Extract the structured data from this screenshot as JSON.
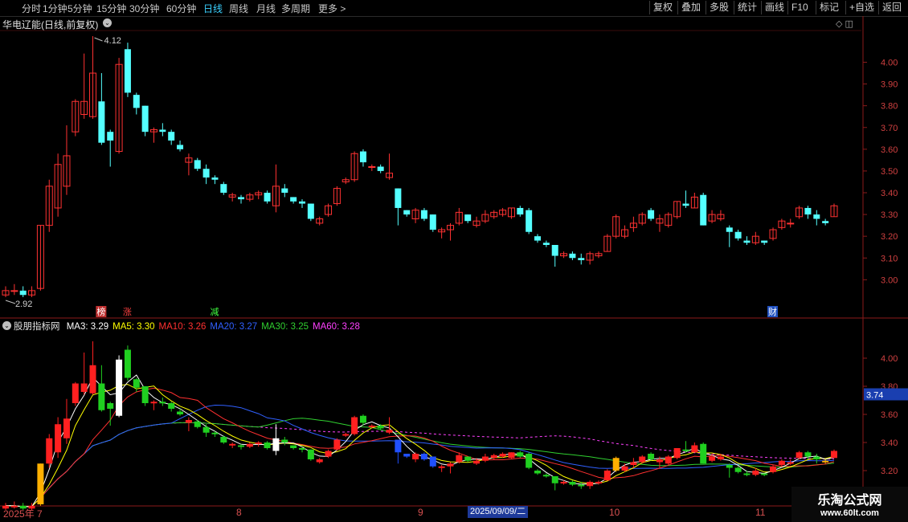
{
  "toolbar": {
    "periods": [
      {
        "label": "分时"
      },
      {
        "label": "1分钟"
      },
      {
        "label": "5分钟"
      },
      {
        "label": "15分钟"
      },
      {
        "label": "30分钟"
      },
      {
        "label": "60分钟"
      },
      {
        "label": "日线"
      },
      {
        "label": "周线"
      },
      {
        "label": "月线"
      },
      {
        "label": "多周期"
      },
      {
        "label": "更多 >"
      }
    ],
    "active": "日线",
    "right_buttons": [
      {
        "label": "复权"
      },
      {
        "label": "叠加"
      },
      {
        "label": "多股"
      },
      {
        "label": "统计"
      },
      {
        "label": "画线"
      },
      {
        "label": "F10"
      },
      {
        "label": "标记"
      },
      {
        "label": "+自选"
      },
      {
        "label": "返回"
      }
    ]
  },
  "main_title": "华电辽能(日线,前复权)",
  "indicator": {
    "name": "股朋指标网",
    "ma": [
      {
        "label": "MA3: 3.29",
        "color": "#ffffff"
      },
      {
        "label": "MA5: 3.30",
        "color": "#ffff00"
      },
      {
        "label": "MA10: 3.26",
        "color": "#ff3030"
      },
      {
        "label": "MA20: 3.27",
        "color": "#3060ff"
      },
      {
        "label": "MA30: 3.25",
        "color": "#30d030"
      },
      {
        "label": "MA60: 3.28",
        "color": "#ff40ff"
      }
    ]
  },
  "markers": {
    "high_label": "4.12",
    "low_label": "2.92",
    "events": [
      {
        "text": "榜",
        "color": "#ffffff",
        "bg": "#c03030"
      },
      {
        "text": "涨",
        "color": "#ff4040",
        "bg": ""
      },
      {
        "text": "减",
        "color": "#40ff40",
        "bg": ""
      },
      {
        "text": "财",
        "color": "#ffffff",
        "bg": "#2050c0"
      }
    ]
  },
  "price_labels": {
    "main_ticks": [
      "4.00",
      "3.90",
      "3.80",
      "3.70",
      "3.60",
      "3.50",
      "3.40",
      "3.30",
      "3.20",
      "3.10",
      "3.00"
    ],
    "sub_ticks": [
      "4.00",
      "3.80",
      "3.60",
      "3.40",
      "3.20"
    ],
    "current_price": "3.74"
  },
  "date_axis": [
    "2025年 7",
    "8",
    "9",
    "10",
    "11"
  ],
  "current_date": "2025/09/09/二",
  "watermark": {
    "title": "乐淘公式网",
    "url": "www.60lt.com"
  },
  "chart_data": {
    "type": "candlestick",
    "title": "华电辽能(日线,前复权)",
    "ylim_main": [
      2.92,
      4.12
    ],
    "ylim_sub": [
      3.12,
      4.12
    ],
    "up_color": "#ff3232",
    "down_color": "#54ffff",
    "candles": [
      {
        "o": 2.93,
        "h": 2.97,
        "l": 2.92,
        "c": 2.95
      },
      {
        "o": 2.95,
        "h": 2.98,
        "l": 2.93,
        "c": 2.95
      },
      {
        "o": 2.95,
        "h": 2.97,
        "l": 2.92,
        "c": 2.93
      },
      {
        "o": 2.93,
        "h": 2.97,
        "l": 2.92,
        "c": 2.95
      },
      {
        "o": 2.96,
        "h": 3.25,
        "l": 2.95,
        "c": 3.25
      },
      {
        "o": 3.25,
        "h": 3.46,
        "l": 3.22,
        "c": 3.43
      },
      {
        "o": 3.33,
        "h": 3.58,
        "l": 3.29,
        "c": 3.53
      },
      {
        "o": 3.43,
        "h": 3.71,
        "l": 3.39,
        "c": 3.57
      },
      {
        "o": 3.68,
        "h": 3.83,
        "l": 3.66,
        "c": 3.82
      },
      {
        "o": 3.76,
        "h": 4.04,
        "l": 3.74,
        "c": 3.82
      },
      {
        "o": 3.75,
        "h": 4.12,
        "l": 3.74,
        "c": 3.95
      },
      {
        "o": 3.82,
        "h": 3.95,
        "l": 3.62,
        "c": 3.63
      },
      {
        "o": 3.68,
        "h": 3.69,
        "l": 3.52,
        "c": 3.64
      },
      {
        "o": 3.59,
        "h": 4.02,
        "l": 3.58,
        "c": 3.99
      },
      {
        "o": 4.06,
        "h": 4.09,
        "l": 3.84,
        "c": 3.86
      },
      {
        "o": 3.85,
        "h": 3.86,
        "l": 3.76,
        "c": 3.79
      },
      {
        "o": 3.8,
        "h": 3.8,
        "l": 3.66,
        "c": 3.68
      },
      {
        "o": 3.68,
        "h": 3.7,
        "l": 3.63,
        "c": 3.69
      },
      {
        "o": 3.69,
        "h": 3.72,
        "l": 3.66,
        "c": 3.68
      },
      {
        "o": 3.68,
        "h": 3.69,
        "l": 3.62,
        "c": 3.64
      },
      {
        "o": 3.62,
        "h": 3.64,
        "l": 3.59,
        "c": 3.6
      },
      {
        "o": 3.54,
        "h": 3.58,
        "l": 3.48,
        "c": 3.56
      },
      {
        "o": 3.55,
        "h": 3.56,
        "l": 3.5,
        "c": 3.51
      },
      {
        "o": 3.51,
        "h": 3.53,
        "l": 3.44,
        "c": 3.47
      },
      {
        "o": 3.47,
        "h": 3.48,
        "l": 3.44,
        "c": 3.46
      },
      {
        "o": 3.44,
        "h": 3.45,
        "l": 3.39,
        "c": 3.4
      },
      {
        "o": 3.38,
        "h": 3.4,
        "l": 3.36,
        "c": 3.39
      },
      {
        "o": 3.38,
        "h": 3.39,
        "l": 3.35,
        "c": 3.37
      },
      {
        "o": 3.37,
        "h": 3.4,
        "l": 3.36,
        "c": 3.39
      },
      {
        "o": 3.39,
        "h": 3.41,
        "l": 3.37,
        "c": 3.4
      },
      {
        "o": 3.4,
        "h": 3.41,
        "l": 3.35,
        "c": 3.36
      },
      {
        "o": 3.34,
        "h": 3.53,
        "l": 3.31,
        "c": 3.43
      },
      {
        "o": 3.42,
        "h": 3.44,
        "l": 3.38,
        "c": 3.4
      },
      {
        "o": 3.38,
        "h": 3.38,
        "l": 3.35,
        "c": 3.36
      },
      {
        "o": 3.36,
        "h": 3.37,
        "l": 3.33,
        "c": 3.35
      },
      {
        "o": 3.35,
        "h": 3.35,
        "l": 3.27,
        "c": 3.28
      },
      {
        "o": 3.26,
        "h": 3.29,
        "l": 3.25,
        "c": 3.28
      },
      {
        "o": 3.3,
        "h": 3.35,
        "l": 3.29,
        "c": 3.34
      },
      {
        "o": 3.35,
        "h": 3.43,
        "l": 3.34,
        "c": 3.42
      },
      {
        "o": 3.45,
        "h": 3.47,
        "l": 3.44,
        "c": 3.46
      },
      {
        "o": 3.46,
        "h": 3.59,
        "l": 3.45,
        "c": 3.58
      },
      {
        "o": 3.59,
        "h": 3.6,
        "l": 3.52,
        "c": 3.54
      },
      {
        "o": 3.52,
        "h": 3.53,
        "l": 3.5,
        "c": 3.52
      },
      {
        "o": 3.52,
        "h": 3.53,
        "l": 3.49,
        "c": 3.5
      },
      {
        "o": 3.47,
        "h": 3.58,
        "l": 3.46,
        "c": 3.49
      },
      {
        "o": 3.42,
        "h": 3.42,
        "l": 3.25,
        "c": 3.33
      },
      {
        "o": 3.32,
        "h": 3.32,
        "l": 3.29,
        "c": 3.3
      },
      {
        "o": 3.28,
        "h": 3.33,
        "l": 3.26,
        "c": 3.32
      },
      {
        "o": 3.32,
        "h": 3.33,
        "l": 3.27,
        "c": 3.28
      },
      {
        "o": 3.3,
        "h": 3.3,
        "l": 3.22,
        "c": 3.23
      },
      {
        "o": 3.22,
        "h": 3.24,
        "l": 3.19,
        "c": 3.23
      },
      {
        "o": 3.23,
        "h": 3.26,
        "l": 3.18,
        "c": 3.25
      },
      {
        "o": 3.26,
        "h": 3.33,
        "l": 3.25,
        "c": 3.31
      },
      {
        "o": 3.3,
        "h": 3.3,
        "l": 3.26,
        "c": 3.27
      },
      {
        "o": 3.25,
        "h": 3.29,
        "l": 3.24,
        "c": 3.27
      },
      {
        "o": 3.27,
        "h": 3.32,
        "l": 3.26,
        "c": 3.3
      },
      {
        "o": 3.29,
        "h": 3.32,
        "l": 3.28,
        "c": 3.31
      },
      {
        "o": 3.3,
        "h": 3.33,
        "l": 3.29,
        "c": 3.32
      },
      {
        "o": 3.29,
        "h": 3.33,
        "l": 3.28,
        "c": 3.33
      },
      {
        "o": 3.33,
        "h": 3.34,
        "l": 3.29,
        "c": 3.3
      },
      {
        "o": 3.32,
        "h": 3.33,
        "l": 3.21,
        "c": 3.22
      },
      {
        "o": 3.2,
        "h": 3.21,
        "l": 3.17,
        "c": 3.18
      },
      {
        "o": 3.17,
        "h": 3.18,
        "l": 3.15,
        "c": 3.16
      },
      {
        "o": 3.16,
        "h": 3.16,
        "l": 3.06,
        "c": 3.11
      },
      {
        "o": 3.11,
        "h": 3.13,
        "l": 3.1,
        "c": 3.12
      },
      {
        "o": 3.12,
        "h": 3.13,
        "l": 3.09,
        "c": 3.1
      },
      {
        "o": 3.1,
        "h": 3.12,
        "l": 3.07,
        "c": 3.09
      },
      {
        "o": 3.09,
        "h": 3.13,
        "l": 3.07,
        "c": 3.12
      },
      {
        "o": 3.11,
        "h": 3.13,
        "l": 3.1,
        "c": 3.12
      },
      {
        "o": 3.13,
        "h": 3.21,
        "l": 3.13,
        "c": 3.2
      },
      {
        "o": 3.2,
        "h": 3.3,
        "l": 3.19,
        "c": 3.29
      },
      {
        "o": 3.2,
        "h": 3.25,
        "l": 3.19,
        "c": 3.23
      },
      {
        "o": 3.24,
        "h": 3.29,
        "l": 3.22,
        "c": 3.26
      },
      {
        "o": 3.26,
        "h": 3.31,
        "l": 3.25,
        "c": 3.3
      },
      {
        "o": 3.32,
        "h": 3.33,
        "l": 3.27,
        "c": 3.28
      },
      {
        "o": 3.26,
        "h": 3.3,
        "l": 3.22,
        "c": 3.28
      },
      {
        "o": 3.25,
        "h": 3.31,
        "l": 3.24,
        "c": 3.3
      },
      {
        "o": 3.29,
        "h": 3.36,
        "l": 3.28,
        "c": 3.36
      },
      {
        "o": 3.35,
        "h": 3.41,
        "l": 3.33,
        "c": 3.34
      },
      {
        "o": 3.33,
        "h": 3.4,
        "l": 3.33,
        "c": 3.38
      },
      {
        "o": 3.39,
        "h": 3.4,
        "l": 3.25,
        "c": 3.25
      },
      {
        "o": 3.27,
        "h": 3.32,
        "l": 3.26,
        "c": 3.3
      },
      {
        "o": 3.28,
        "h": 3.32,
        "l": 3.27,
        "c": 3.3
      },
      {
        "o": 3.24,
        "h": 3.25,
        "l": 3.15,
        "c": 3.22
      },
      {
        "o": 3.22,
        "h": 3.23,
        "l": 3.18,
        "c": 3.19
      },
      {
        "o": 3.18,
        "h": 3.2,
        "l": 3.16,
        "c": 3.17
      },
      {
        "o": 3.17,
        "h": 3.22,
        "l": 3.16,
        "c": 3.2
      },
      {
        "o": 3.18,
        "h": 3.18,
        "l": 3.16,
        "c": 3.17
      },
      {
        "o": 3.19,
        "h": 3.24,
        "l": 3.18,
        "c": 3.23
      },
      {
        "o": 3.24,
        "h": 3.28,
        "l": 3.23,
        "c": 3.27
      },
      {
        "o": 3.26,
        "h": 3.28,
        "l": 3.24,
        "c": 3.26
      },
      {
        "o": 3.29,
        "h": 3.34,
        "l": 3.28,
        "c": 3.33
      },
      {
        "o": 3.33,
        "h": 3.34,
        "l": 3.28,
        "c": 3.3
      },
      {
        "o": 3.3,
        "h": 3.32,
        "l": 3.25,
        "c": 3.28
      },
      {
        "o": 3.27,
        "h": 3.28,
        "l": 3.25,
        "c": 3.26
      },
      {
        "o": 3.29,
        "h": 3.35,
        "l": 3.29,
        "c": 3.34
      }
    ]
  }
}
